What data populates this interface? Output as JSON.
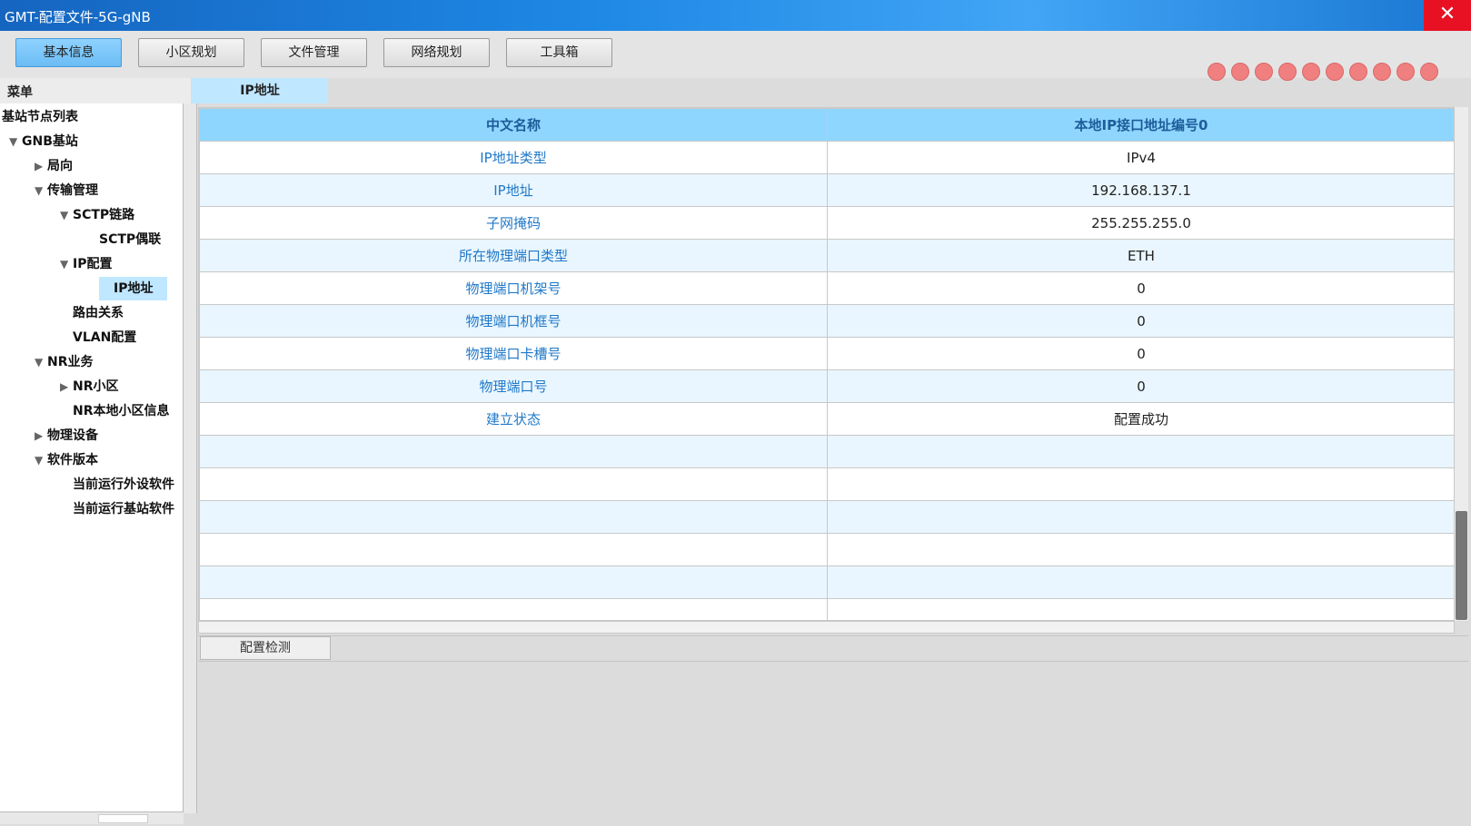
{
  "window": {
    "title": "GMT-配置文件-5G-gNB",
    "close_symbol": "✕"
  },
  "toolbar": {
    "buttons": [
      {
        "label": "基本信息",
        "active": true
      },
      {
        "label": "小区规划",
        "active": false
      },
      {
        "label": "文件管理",
        "active": false
      },
      {
        "label": "网络规划",
        "active": false
      },
      {
        "label": "工具箱",
        "active": false
      }
    ],
    "status_dot_count": 10,
    "status_dot_color": "#f08080"
  },
  "sidebar": {
    "header": "菜单",
    "items": [
      {
        "label": "基站节点列表",
        "level": 0,
        "arrow": ""
      },
      {
        "label": "GNB基站",
        "level": 1,
        "arrow": "▼"
      },
      {
        "label": "局向",
        "level": 2,
        "arrow": "▶"
      },
      {
        "label": "传输管理",
        "level": 2,
        "arrow": "▼"
      },
      {
        "label": "SCTP链路",
        "level": 3,
        "arrow": "▼"
      },
      {
        "label": "SCTP偶联",
        "level": 4,
        "arrow": ""
      },
      {
        "label": "IP配置",
        "level": 3,
        "arrow": "▼"
      },
      {
        "label": "IP地址",
        "level": 4,
        "arrow": "",
        "selected": true
      },
      {
        "label": "路由关系",
        "level": 3,
        "arrow": ""
      },
      {
        "label": "VLAN配置",
        "level": 3,
        "arrow": ""
      },
      {
        "label": "NR业务",
        "level": 2,
        "arrow": "▼"
      },
      {
        "label": "NR小区",
        "level": 3,
        "arrow": "▶"
      },
      {
        "label": "NR本地小区信息",
        "level": 3,
        "arrow": ""
      },
      {
        "label": "物理设备",
        "level": 2,
        "arrow": "▶"
      },
      {
        "label": "软件版本",
        "level": 2,
        "arrow": "▼"
      },
      {
        "label": "当前运行外设软件",
        "level": 3,
        "arrow": ""
      },
      {
        "label": "当前运行基站软件",
        "level": 3,
        "arrow": ""
      }
    ]
  },
  "main": {
    "tab_label": "IP地址",
    "table": {
      "headers": [
        "中文名称",
        "本地IP接口地址编号0"
      ],
      "rows": [
        [
          "IP地址类型",
          "IPv4"
        ],
        [
          "IP地址",
          "192.168.137.1"
        ],
        [
          "子网掩码",
          "255.255.255.0"
        ],
        [
          "所在物理端口类型",
          "ETH"
        ],
        [
          "物理端口机架号",
          "0"
        ],
        [
          "物理端口机框号",
          "0"
        ],
        [
          "物理端口卡槽号",
          "0"
        ],
        [
          "物理端口号",
          "0"
        ],
        [
          "建立状态",
          "配置成功"
        ]
      ],
      "empty_rows": 6
    }
  },
  "bottom": {
    "tab_label": "配置检测"
  },
  "colors": {
    "accent": "#8fd6ff",
    "selected": "#bfe7ff",
    "close": "#e81123"
  }
}
